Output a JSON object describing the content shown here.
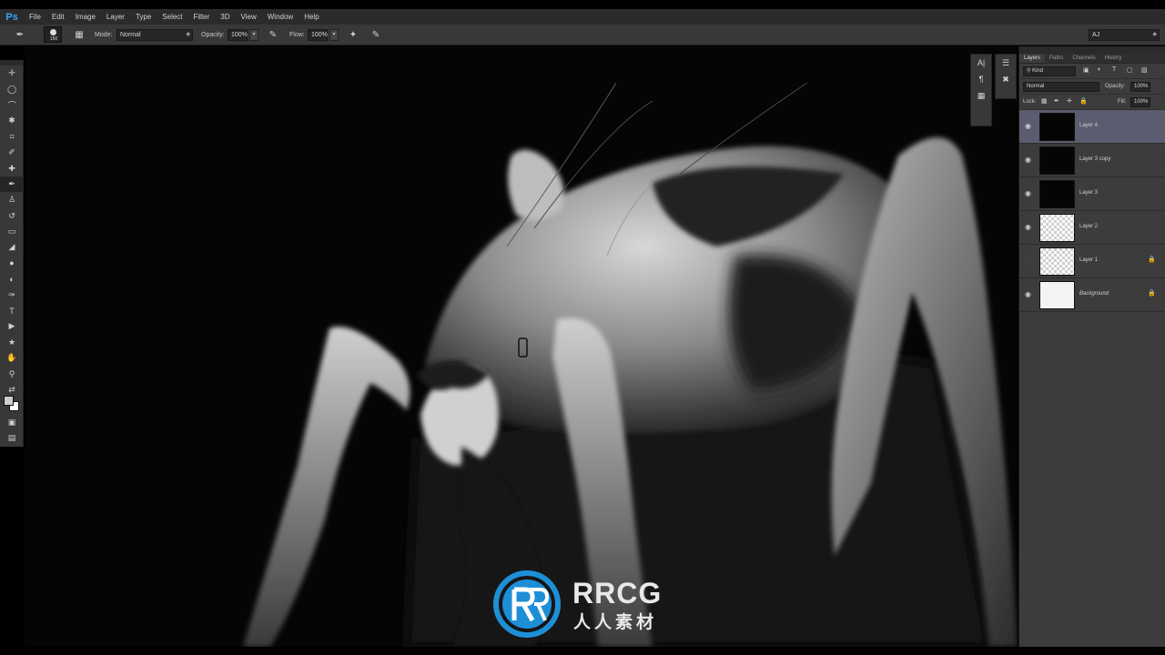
{
  "app": {
    "logo": "Ps"
  },
  "menu": [
    "File",
    "Edit",
    "Image",
    "Layer",
    "Type",
    "Select",
    "Filter",
    "3D",
    "View",
    "Window",
    "Help"
  ],
  "options_bar": {
    "brush_size": "150",
    "mode_label": "Mode:",
    "mode_value": "Normal",
    "opacity_label": "Opacity:",
    "opacity_value": "100%",
    "flow_label": "Flow:",
    "flow_value": "100%",
    "workspace_value": "AJ"
  },
  "panel_tabs": [
    "Layers",
    "Paths",
    "Channels",
    "History"
  ],
  "layers_panel": {
    "filter_kind": "Kind",
    "blend_mode": "Normal",
    "opacity_label": "Opacity:",
    "opacity_value": "100%",
    "lock_label": "Lock:",
    "fill_label": "Fill:",
    "fill_value": "100%",
    "layers": [
      {
        "name": "Layer 4",
        "selected": true,
        "visible": true,
        "locked": false,
        "thumb": "dark"
      },
      {
        "name": "Layer 3 copy",
        "selected": false,
        "visible": true,
        "locked": false,
        "thumb": "dark"
      },
      {
        "name": "Layer 3",
        "selected": false,
        "visible": true,
        "locked": false,
        "thumb": "dark"
      },
      {
        "name": "Layer 2",
        "selected": false,
        "visible": true,
        "locked": false,
        "thumb": "checker"
      },
      {
        "name": "Layer 1",
        "selected": false,
        "visible": false,
        "locked": true,
        "thumb": "checker"
      },
      {
        "name": "Background",
        "selected": false,
        "visible": true,
        "locked": true,
        "thumb": "white"
      }
    ]
  },
  "watermark": {
    "title": "RRCG",
    "subtitle": "人人素材"
  },
  "colors": {
    "accent": "#31a8ff",
    "selected_layer": "#5a5d6f",
    "watermark_blue": "#1e8fd6"
  }
}
